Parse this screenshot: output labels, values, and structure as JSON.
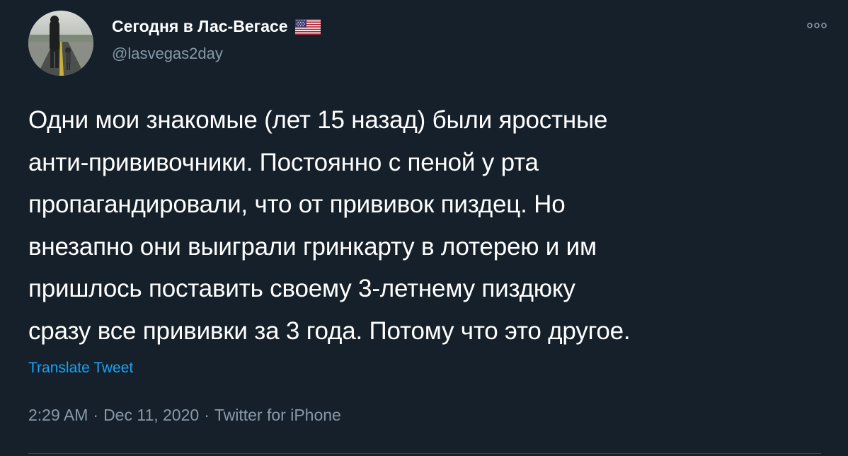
{
  "author": {
    "display_name": "Сегодня в Лас-Вегасе",
    "handle": "@lasvegas2day",
    "flag_icon": "us-flag-icon"
  },
  "tweet": {
    "text": "Одни мои знакомые (лет 15 назад) были яростные\nанти-прививочники. Постоянно с пеной у рта\nпропагандировали, что от прививок пиздец. Но\nвнезапно они выиграли гринкарту в лотерею и им\nпришлось поставить своему 3-летнему пиздюку\nсразу все прививки за 3 года. Потому что это другое.",
    "translate_label": "Translate Tweet"
  },
  "meta": {
    "time": "2:29 AM",
    "separator": "·",
    "date": "Dec 11, 2020",
    "source": "Twitter for iPhone"
  },
  "colors": {
    "background": "#15202b",
    "text_primary": "#ffffff",
    "text_secondary": "#8899a6",
    "link": "#1da1f2",
    "divider": "#38444d"
  },
  "icons": {
    "more": "more-options-icon"
  }
}
